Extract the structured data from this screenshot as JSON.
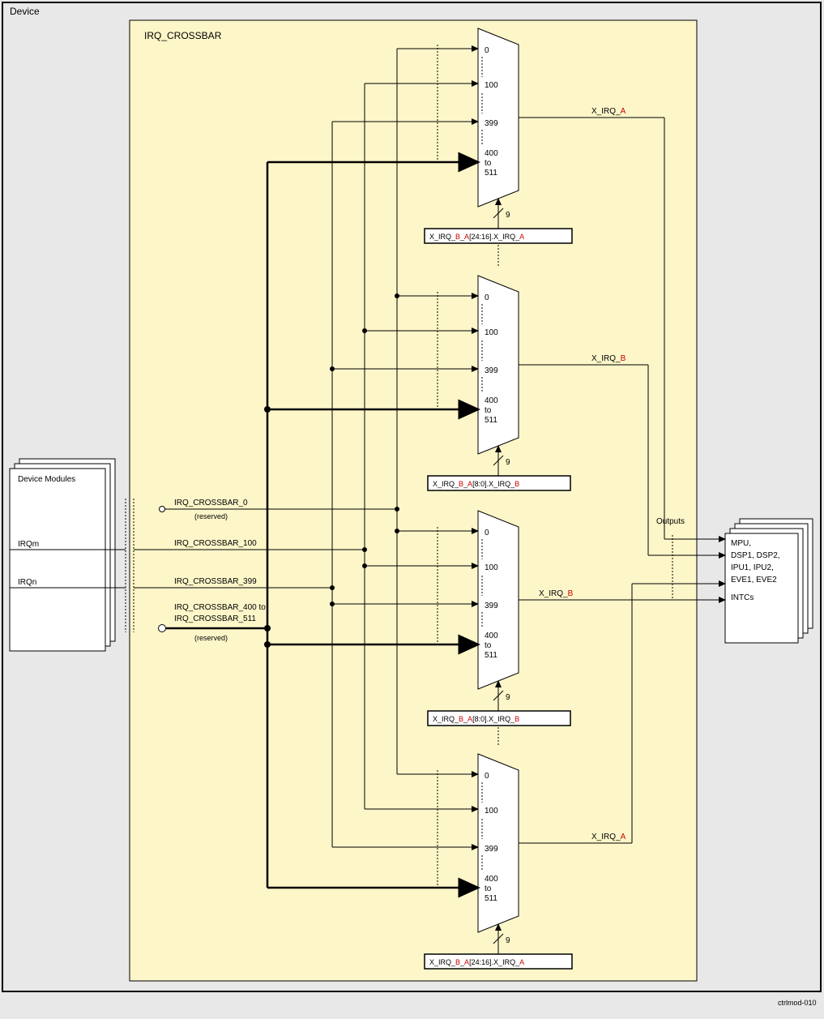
{
  "outer_label": "Device",
  "crossbar_label": "IRQ_CROSSBAR",
  "left_module": {
    "title": "Device Modules",
    "irq_m": "IRQm",
    "irq_n": "IRQn"
  },
  "inputs": {
    "in0": "IRQ_CROSSBAR_0",
    "in0_res": "(reserved)",
    "in100": "IRQ_CROSSBAR_100",
    "in399": "IRQ_CROSSBAR_399",
    "in400a": "IRQ_CROSSBAR_400 to",
    "in400b": "IRQ_CROSSBAR_511",
    "in400_res": "(reserved)"
  },
  "mux_ports": {
    "p0": "0",
    "p100": "100",
    "p399": "399",
    "p400a": "400",
    "p400b": "to",
    "p400c": "511"
  },
  "sel_bits": "9",
  "out_a": "X_IRQ_A",
  "out_b": "X_IRQ_B",
  "reg_top": {
    "pre": "X_IRQ_",
    "b": "B",
    "mid": "_",
    "a": "A",
    "bits": "[24:16]",
    "sig_pre": "X_IRQ_",
    "sig_suf": "A"
  },
  "reg_topmid": {
    "pre": "X_IRQ_",
    "b": "B",
    "mid": "_",
    "a": "A",
    "bits": "[8:0]",
    "sig_pre": "X_IRQ_",
    "sig_suf": "B"
  },
  "reg_botmid": {
    "pre": "X_IRQ_",
    "b": "B",
    "mid": "_",
    "a": "A",
    "bits": "[8:0]",
    "sig_pre": "X_IRQ_",
    "sig_suf": "B"
  },
  "reg_bot": {
    "pre": "X_IRQ_",
    "b": "B",
    "mid": "_",
    "a": "A",
    "bits": "[24:16]",
    "sig_pre": "X_IRQ_",
    "sig_suf": "A"
  },
  "outputs_label": "Outputs",
  "right_module": {
    "l1": "MPU,",
    "l2": "DSP1, DSP2,",
    "l3": "IPU1, IPU2,",
    "l4": "EVE1, EVE2",
    "l5": "INTCs"
  },
  "caption": "ctrlmod-010"
}
